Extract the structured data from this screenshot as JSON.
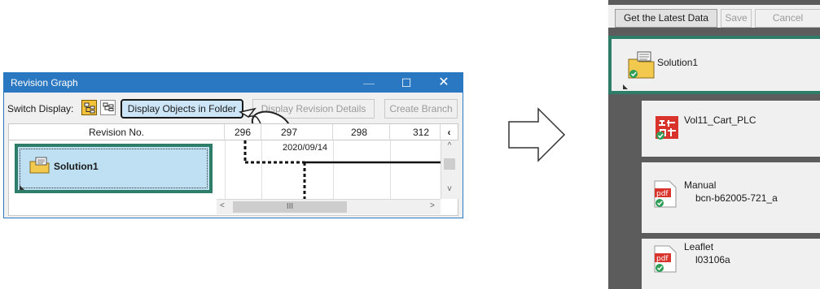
{
  "revision_graph": {
    "title": "Revision Graph",
    "window_buttons": {
      "minimize": "—",
      "maximize": "☐",
      "close": "✕"
    },
    "switch_display_label": "Switch Display:",
    "buttons": {
      "display_objects": "Display Objects in Folder",
      "display_revision_details": "Display Revision Details",
      "create_branch": "Create Branch"
    },
    "columns": [
      "Revision No.",
      "296",
      "297",
      "298",
      "312"
    ],
    "header_arrow": "‹",
    "date": "2020/09/14",
    "node_label": "Solution1",
    "scroll": {
      "up": "^",
      "down": "v",
      "left": "<",
      "right": ">",
      "thumb": "III"
    }
  },
  "panel": {
    "toolbar": {
      "get_latest": "Get the Latest Data",
      "save": "Save",
      "cancel": "Cancel"
    },
    "solution": "Solution1",
    "items": [
      {
        "name": "Vol11_Cart_PLC",
        "sub": "",
        "icon": "plc-project-icon"
      },
      {
        "name": "Manual",
        "sub": "bcn-b62005-721_a",
        "icon": "pdf-icon"
      },
      {
        "name": "Leaflet",
        "sub": "l03106a",
        "icon": "pdf-icon"
      }
    ]
  },
  "colors": {
    "accent_blue": "#2b78c2",
    "selection_green": "#2e7d68",
    "node_fill": "#bfe0f3",
    "panel_bg": "#5c5c5c"
  }
}
